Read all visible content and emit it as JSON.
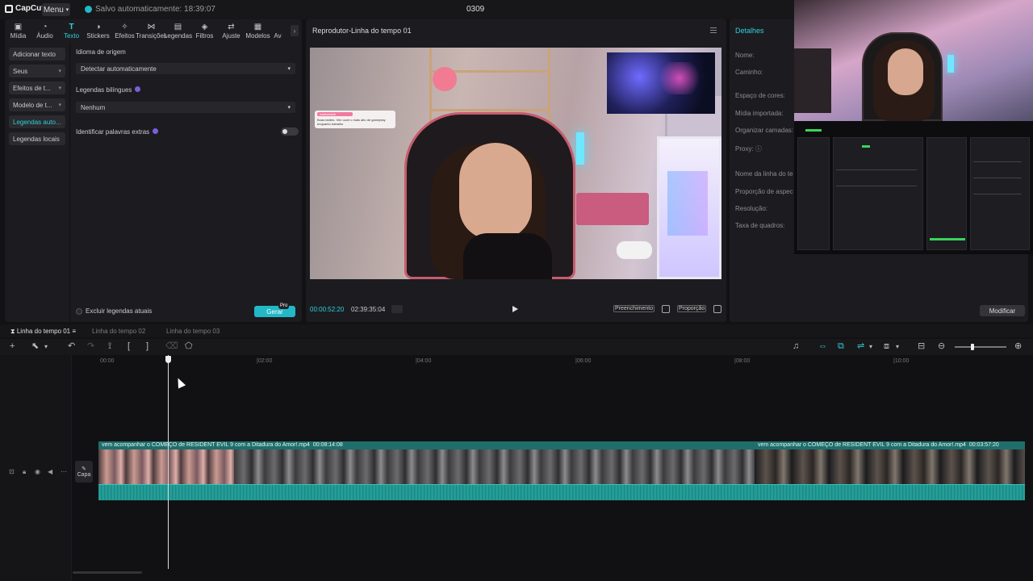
{
  "app": {
    "logo": "CapCut",
    "menu_label": "Menu",
    "autosave_text": "Salvo automaticamente: 18:39:07",
    "project_title": "0309"
  },
  "toolbar": {
    "items": [
      {
        "label": "Mídia",
        "icon": "media-icon"
      },
      {
        "label": "Áudio",
        "icon": "audio-icon"
      },
      {
        "label": "Texto",
        "icon": "text-icon",
        "active": true
      },
      {
        "label": "Stickers",
        "icon": "sticker-icon"
      },
      {
        "label": "Efeitos",
        "icon": "effects-icon"
      },
      {
        "label": "Transições",
        "icon": "transitions-icon"
      },
      {
        "label": "Legendas",
        "icon": "captions-icon"
      },
      {
        "label": "Filtros",
        "icon": "filters-icon"
      },
      {
        "label": "Ajuste",
        "icon": "adjust-icon"
      },
      {
        "label": "Modelos",
        "icon": "templates-icon"
      },
      {
        "label": "Av",
        "icon": "more-icon"
      }
    ]
  },
  "text_panel": {
    "categories": [
      {
        "label": "Adicionar texto",
        "chevron": false,
        "active": false
      },
      {
        "label": "Seus",
        "chevron": true,
        "active": false
      },
      {
        "label": "Efeitos de t...",
        "chevron": true,
        "active": false
      },
      {
        "label": "Modelo de t...",
        "chevron": true,
        "active": false
      },
      {
        "label": "Legendas auto...",
        "chevron": false,
        "active": true
      },
      {
        "label": "Legendas locais",
        "chevron": false,
        "active": false
      }
    ],
    "source_language_label": "Idioma de origem",
    "source_language_value": "Detectar automaticamente",
    "bilingual_label": "Legendas bilíngues",
    "bilingual_value": "Nenhum",
    "extra_words_label": "Identificar palavras extras",
    "exclude_label": "Excluir legendas atuais",
    "generate_label": "Gerar",
    "pro_badge": "Pro"
  },
  "player": {
    "title": "Reprodutor-Linha do tempo 01",
    "current_time": "00:00:52:20",
    "duration": "02:39:35:04",
    "fill_label": "Preenchimento",
    "ratio_label": "Proporção",
    "chat_name": "icallmebeth",
    "chat_message": "Boas tardes. Vim ouvir o mais alto de gameplay enquanto trabalho"
  },
  "details": {
    "title": "Detalhes",
    "fields": [
      "Nome:",
      "Caminho:",
      "Espaço de cores:",
      "Mídia importada:",
      "Organizar camadas:",
      "Proxy:",
      "Nome da linha do te",
      "Proporção de aspec",
      "Resolução:",
      "Taxa de quadros:"
    ],
    "modify_label": "Modificar"
  },
  "timeline": {
    "tabs": [
      "Linha do tempo 01",
      "Linha do tempo 02",
      "Linha do tempo 03"
    ],
    "ruler": [
      "00:00",
      "|02:00",
      "|04:00",
      "|06:00",
      "|08:00",
      "|10:00"
    ],
    "cover_label": "Capa",
    "clips": [
      {
        "name": "vem acompanhar o COMEÇO de RESIDENT EVIL 9 com a Ditadura do Amor!.mp4",
        "duration": "00:08:14:08"
      },
      {
        "name": "vem acompanhar o COMEÇO de RESIDENT EVIL 9 com a Ditadura do Amor!.mp4",
        "duration": "00:03:57:20"
      }
    ]
  },
  "colors": {
    "accent": "#2fd0d9",
    "clip_header": "#1f6e6b",
    "audio_wave": "#26a6a0",
    "background": "#121215"
  }
}
